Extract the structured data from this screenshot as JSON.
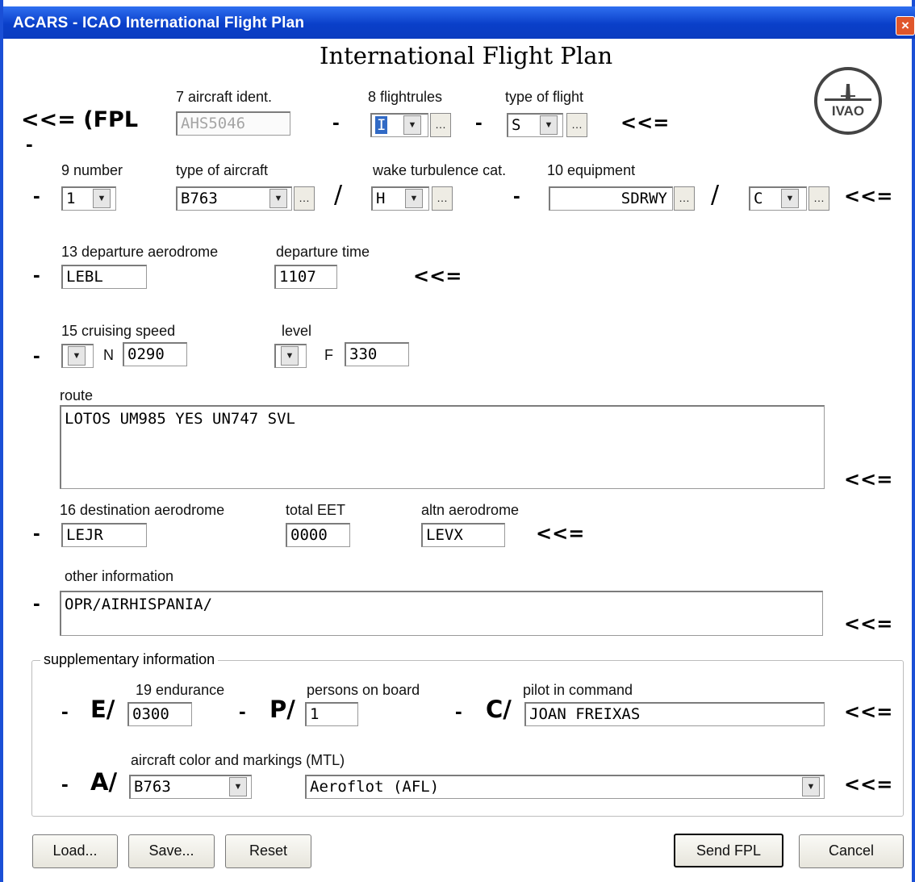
{
  "window": {
    "title": "ACARS - ICAO International Flight Plan",
    "close_glyph": "×"
  },
  "form_title": "International Flight Plan",
  "logo_text": "IVAO",
  "markers": {
    "back": "<<=",
    "dash": "-",
    "slash": "/"
  },
  "row1": {
    "prefix": "<<= (FPL",
    "aircraft_ident": {
      "label": "7 aircraft ident.",
      "value": "AHS5046"
    },
    "flightrules": {
      "label": "8 flightrules",
      "value": "I"
    },
    "type_of_flight": {
      "label": "type of flight",
      "value": "S"
    }
  },
  "row2": {
    "number": {
      "label": "9 number",
      "value": "1"
    },
    "type_of_aircraft": {
      "label": "type of aircraft",
      "value": "B763"
    },
    "wake": {
      "label": "wake turbulence cat.",
      "value": "H"
    },
    "equipment": {
      "label": "10 equipment",
      "value": "SDRWY",
      "transponder": "C"
    }
  },
  "row3": {
    "departure": {
      "label": "13 departure aerodrome",
      "value": "LEBL"
    },
    "departure_time": {
      "label": "departure time",
      "value": "1107"
    }
  },
  "row4": {
    "speed": {
      "label": "15 cruising speed",
      "unit": "N",
      "value": "0290"
    },
    "level": {
      "label": "level",
      "unit": "F",
      "value": "330"
    }
  },
  "route": {
    "label": "route",
    "value": "LOTOS UM985 YES UN747 SVL"
  },
  "row6": {
    "destination": {
      "label": "16 destination aerodrome",
      "value": "LEJR"
    },
    "total_eet": {
      "label": "total EET",
      "value": "0000"
    },
    "altn": {
      "label": "altn aerodrome",
      "value": "LEVX"
    }
  },
  "other": {
    "label": "other information",
    "value": "OPR/AIRHISPANIA/"
  },
  "supplementary": {
    "label": "supplementary information",
    "endurance": {
      "prefix": "E/",
      "label": "19 endurance",
      "value": "0300"
    },
    "persons": {
      "prefix": "P/",
      "label": "persons on board",
      "value": "1"
    },
    "pic": {
      "prefix": "C/",
      "label": "pilot in command",
      "value": "JOAN FREIXAS"
    },
    "color": {
      "prefix": "A/",
      "label": "aircraft color and markings (MTL)",
      "value": "B763",
      "livery": "Aeroflot (AFL)"
    }
  },
  "buttons": {
    "load": "Load...",
    "save": "Save...",
    "reset": "Reset",
    "send": "Send FPL",
    "cancel": "Cancel"
  }
}
